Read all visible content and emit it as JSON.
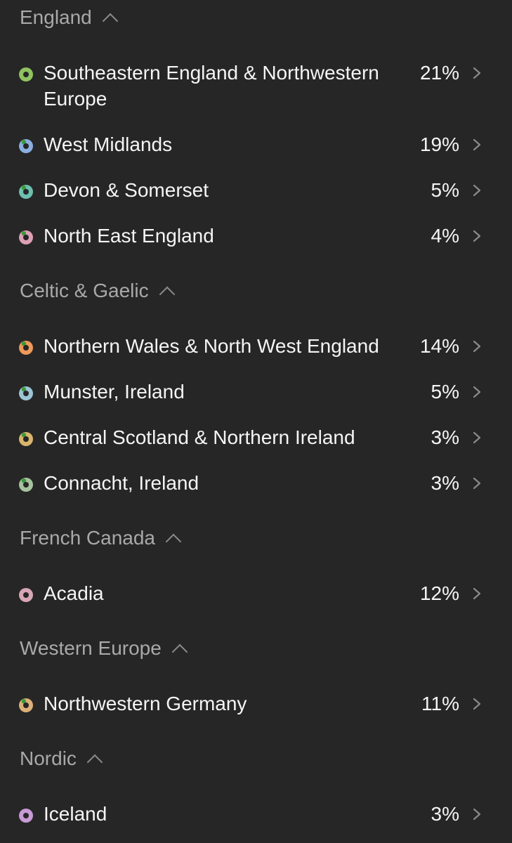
{
  "sections": [
    {
      "title": "England",
      "items": [
        {
          "label": "Southeastern England & Northwestern Europe",
          "percent": "21%",
          "color": "#8ec35e",
          "fraction": 1.0
        },
        {
          "label": "West Midlands",
          "percent": "19%",
          "color": "#8aaedf",
          "fraction": 0.85
        },
        {
          "label": "Devon & Somerset",
          "percent": "5%",
          "color": "#6cc0b0",
          "fraction": 0.85
        },
        {
          "label": "North East England",
          "percent": "4%",
          "color": "#dda0b4",
          "fraction": 0.85
        }
      ]
    },
    {
      "title": "Celtic & Gaelic",
      "items": [
        {
          "label": "Northern Wales & North West England",
          "percent": "14%",
          "color": "#ef995a",
          "fraction": 0.85
        },
        {
          "label": "Munster, Ireland",
          "percent": "5%",
          "color": "#9dc4d6",
          "fraction": 0.85
        },
        {
          "label": "Central Scotland & Northern Ireland",
          "percent": "3%",
          "color": "#d9b56c",
          "fraction": 0.85
        },
        {
          "label": "Connacht, Ireland",
          "percent": "3%",
          "color": "#a6c39e",
          "fraction": 0.85
        }
      ]
    },
    {
      "title": "French Canada",
      "items": [
        {
          "label": "Acadia",
          "percent": "12%",
          "color": "#d8a6b5",
          "fraction": 1.0
        }
      ]
    },
    {
      "title": "Western Europe",
      "items": [
        {
          "label": "Northwestern Germany",
          "percent": "11%",
          "color": "#ddb078",
          "fraction": 0.85
        }
      ]
    },
    {
      "title": "Nordic",
      "items": [
        {
          "label": "Iceland",
          "percent": "3%",
          "color": "#c89ad6",
          "fraction": 1.0
        }
      ]
    }
  ],
  "colors": {
    "background": "#262626",
    "header_text": "#a9a9a9",
    "item_text": "#f5f5f5",
    "chevron": "#8a8a8a",
    "marker_green": "#3a9a3a",
    "dot_center": "#262626"
  },
  "icons": {
    "section_toggle": "chevron-up-icon",
    "row_arrow": "chevron-right-icon",
    "region_marker": "region-dot-icon"
  }
}
